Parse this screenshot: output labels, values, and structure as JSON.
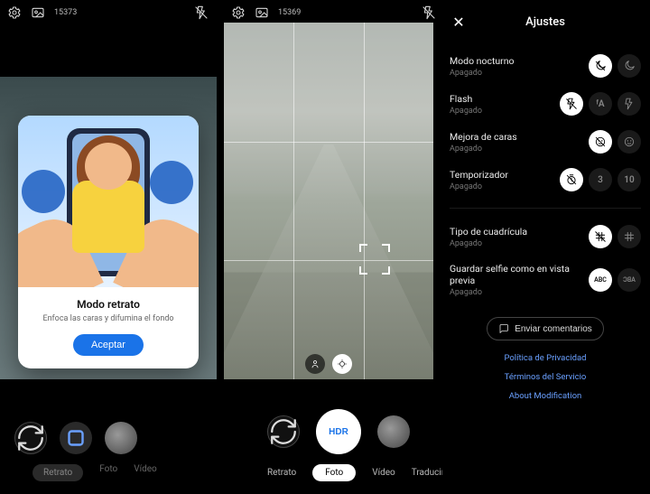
{
  "topbar": {
    "left_count": "15373",
    "right_count": "15369"
  },
  "modal": {
    "title": "Modo retrato",
    "subtitle": "Enfoca las caras y difumina el fondo",
    "accept": "Aceptar"
  },
  "modes": {
    "left": {
      "retrato": "Retrato",
      "foto": "Foto",
      "video": "Vídeo"
    },
    "center": {
      "retrato": "Retrato",
      "foto": "Foto",
      "video": "Vídeo",
      "traducir": "Traducir"
    }
  },
  "shutter": {
    "hdr": "HDR"
  },
  "settings": {
    "title": "Ajustes",
    "night": {
      "label": "Modo nocturno",
      "status": "Apagado"
    },
    "flash": {
      "label": "Flash",
      "status": "Apagado",
      "auto_glyph": "ᶠA"
    },
    "face": {
      "label": "Mejora de caras",
      "status": "Apagado"
    },
    "timer": {
      "label": "Temporizador",
      "status": "Apagado",
      "v3": "3",
      "v10": "10"
    },
    "grid": {
      "label": "Tipo de cuadrícula",
      "status": "Apagado"
    },
    "selfie": {
      "label": "Guardar selfie como en vista previa",
      "status": "Apagado",
      "abc": "ABC",
      "abc_mirror": "ABC"
    },
    "feedback": "Enviar comentarios",
    "links": {
      "privacy": "Política de Privacidad",
      "terms": "Términos del Servicio",
      "about": "About Modification"
    }
  }
}
